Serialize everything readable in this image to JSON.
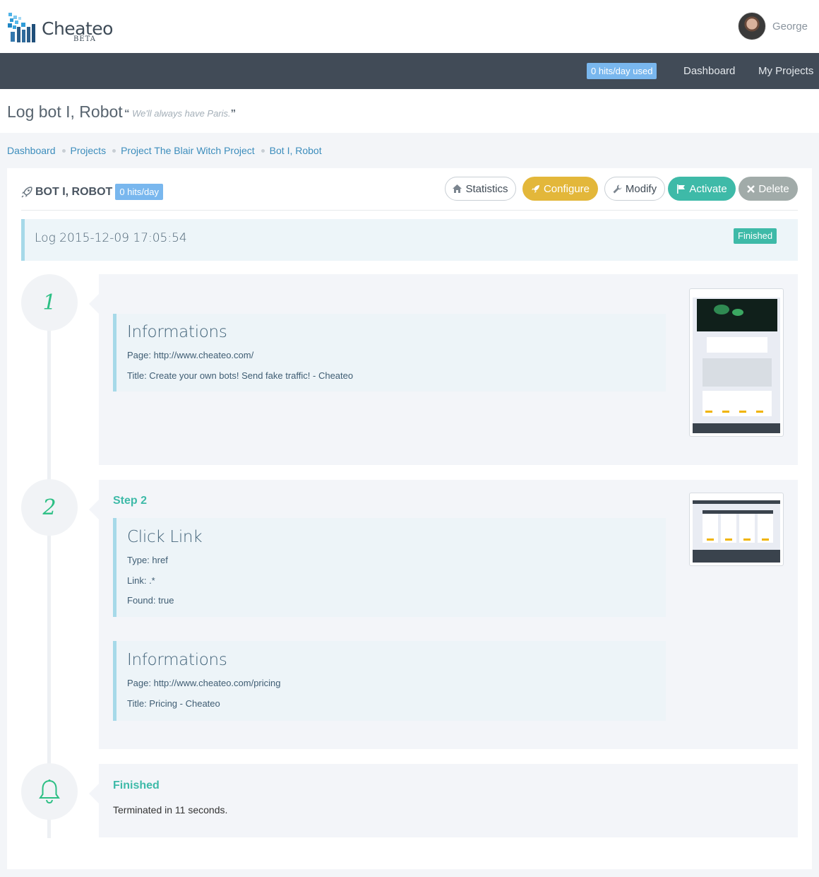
{
  "brand": {
    "name": "Cheateo",
    "tag": "BETA"
  },
  "user": {
    "name": "George"
  },
  "nav": {
    "hits_used": "0 hits/day used",
    "dashboard": "Dashboard",
    "projects": "My Projects"
  },
  "page": {
    "title": "Log bot I, Robot",
    "quote": "We'll always have Paris."
  },
  "breadcrumb": [
    "Dashboard",
    "Projects",
    "Project The Blair Witch Project",
    "Bot I, Robot"
  ],
  "bot": {
    "name": "BOT I, ROBOT",
    "hits": "0 hits/day",
    "actions": {
      "statistics": "Statistics",
      "configure": "Configure",
      "modify": "Modify",
      "activate": "Activate",
      "delete": "Delete"
    }
  },
  "log": {
    "title": "Log 2015-12-09 17:05:54",
    "status": "Finished"
  },
  "steps": [
    {
      "number": "1",
      "info": {
        "title": "Informations",
        "page": "Page: http://www.cheateo.com/",
        "page_title": "Title: Create your own bots! Send fake traffic! - Cheateo"
      }
    },
    {
      "number": "2",
      "label": "Step 2",
      "action": {
        "title": "Click Link",
        "type": "Type: href",
        "link": "Link: .*",
        "found": "Found: true"
      },
      "info": {
        "title": "Informations",
        "page": "Page: http://www.cheateo.com/pricing",
        "page_title": "Title: Pricing - Cheateo"
      }
    }
  ],
  "finish": {
    "title": "Finished",
    "text": "Terminated in 11 seconds."
  },
  "colors": {
    "accent": "#3ebaa8",
    "navbar": "#414b57",
    "link": "#3c8dbc",
    "badge": "#79b7ee",
    "configure": "#e3b73a",
    "step_number": "#2cbf84"
  }
}
